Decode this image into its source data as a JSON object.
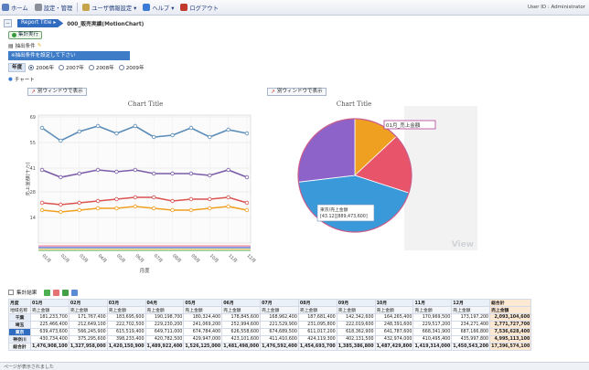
{
  "menu": {
    "items": [
      {
        "label": "ホーム",
        "icon": "home-icon",
        "color": "#5a7fbf"
      },
      {
        "label": "設定・管理",
        "icon": "gear-icon",
        "color": "#8a8f99"
      },
      {
        "label": "ユーザ情報設定 ▾",
        "icon": "user-settings-icon",
        "color": "#c7a34a"
      },
      {
        "label": "ヘルプ ▾",
        "icon": "help-icon",
        "color": "#3a7bd5"
      },
      {
        "label": "ログアウト",
        "icon": "logout-icon",
        "color": "#c0392b"
      }
    ],
    "user": "User ID : Administrator"
  },
  "report": {
    "tab_label": "Report Title ▸",
    "name": "000_販売実績(MotionChart)",
    "collapse_symbol": "−"
  },
  "controls": {
    "exec_label": "集計実行",
    "condition_label": "抽出条件",
    "condition_banner": "※抽出条件を設定して下さい",
    "year_label": "年度",
    "years": [
      {
        "label": "2006年",
        "checked": true
      },
      {
        "label": "2007年",
        "checked": false
      },
      {
        "label": "2008年",
        "checked": false
      },
      {
        "label": "2009年",
        "checked": false
      }
    ],
    "chart_label": "チャート"
  },
  "left_chart": {
    "window_button": "別ウィンドウで表示",
    "title": "Chart Title",
    "ylabel": "売上金額(千万)",
    "xlabel": "月度"
  },
  "right_chart": {
    "window_button": "別ウィンドウで表示",
    "title": "Chart Title",
    "callout_top": "01月_売上金額",
    "callout_mid_1": "東京/売上金額",
    "callout_mid_2": "[43.12][889,473,600]",
    "watermark": "View"
  },
  "chart_data": [
    {
      "type": "line",
      "title": "Chart Title",
      "xlabel": "月度",
      "ylabel": "売上金額(千万)",
      "categories": [
        "01月",
        "02月",
        "03月",
        "04月",
        "05月",
        "06月",
        "07月",
        "08月",
        "09月",
        "10月",
        "11月",
        "12月"
      ],
      "ylim": [
        0,
        70
      ],
      "yticks": [
        14,
        28,
        41,
        55,
        69
      ],
      "grid": true,
      "legend": "none",
      "series": [
        {
          "color": "#5b8db8",
          "values": [
            63,
            56,
            61,
            64,
            60,
            64,
            58,
            59,
            63,
            58,
            62,
            60
          ]
        },
        {
          "color": "#7a5ca8",
          "values": [
            40,
            36,
            38,
            40,
            39,
            40,
            38,
            38,
            38,
            37,
            40,
            36
          ]
        },
        {
          "color": "#d9534f",
          "values": [
            22,
            21,
            22,
            23,
            24,
            25,
            25,
            23,
            24,
            24,
            25,
            22
          ]
        },
        {
          "color": "#f0a020",
          "values": [
            18,
            17,
            18,
            19,
            19,
            20,
            19,
            18,
            18,
            19,
            20,
            18
          ]
        }
      ]
    },
    {
      "type": "pie",
      "title": "Chart Title",
      "slices": [
        {
          "label": "01月_売上金額",
          "value": 13,
          "color": "#f0a020"
        },
        {
          "label": "",
          "value": 17,
          "color": "#e8546a"
        },
        {
          "label": "東京/売上金額",
          "value": 43.12,
          "color": "#3a9ad9"
        },
        {
          "label": "",
          "value": 26.88,
          "color": "#8e63c9"
        }
      ]
    }
  ],
  "results": {
    "label": "集計結果"
  },
  "table": {
    "month_label": "月度",
    "metric_label": "地域名称",
    "grand_label": "総合計",
    "metric_name": "売上金額",
    "months": [
      "01月",
      "02月",
      "03月",
      "04月",
      "05月",
      "06月",
      "07月",
      "08月",
      "09月",
      "10月",
      "11月",
      "12月"
    ],
    "rows": [
      {
        "name": "千葉",
        "values": [
          "181,233,700",
          "171,767,400",
          "183,695,600",
          "190,198,700",
          "180,324,400",
          "178,845,600",
          "168,962,400",
          "187,681,400",
          "142,342,600",
          "164,265,400",
          "170,969,500",
          "173,197,200",
          "2,093,104,600"
        ]
      },
      {
        "name": "埼玉",
        "values": [
          "225,466,400",
          "212,649,100",
          "222,702,500",
          "229,230,200",
          "241,069,200",
          "252,994,600",
          "221,529,900",
          "231,095,800",
          "222,019,600",
          "248,391,600",
          "229,517,200",
          "234,271,400",
          "2,771,727,700"
        ]
      },
      {
        "name": "東京",
        "values": [
          "639,473,600",
          "566,245,900",
          "615,519,400",
          "649,711,000",
          "674,784,400",
          "626,558,600",
          "674,689,500",
          "611,017,200",
          "618,362,900",
          "641,787,600",
          "668,341,900",
          "687,166,800",
          "7,536,628,400"
        ]
      },
      {
        "name": "神奈川",
        "values": [
          "430,734,400",
          "375,295,600",
          "398,233,400",
          "420,782,500",
          "429,947,000",
          "423,101,600",
          "411,410,600",
          "424,119,300",
          "402,131,500",
          "432,974,000",
          "410,495,400",
          "435,997,800",
          "4,995,113,100"
        ]
      }
    ],
    "total": {
      "name": "総合計",
      "values": [
        "1,476,908,100",
        "1,327,958,000",
        "1,420,150,900",
        "1,489,922,400",
        "1,526,125,000",
        "1,481,498,000",
        "1,476,592,400",
        "1,454,693,700",
        "1,385,386,800",
        "1,487,429,800",
        "1,419,314,000",
        "1,450,543,200",
        "17,396,574,100"
      ]
    }
  },
  "status": {
    "text": "ページが表示されました"
  }
}
